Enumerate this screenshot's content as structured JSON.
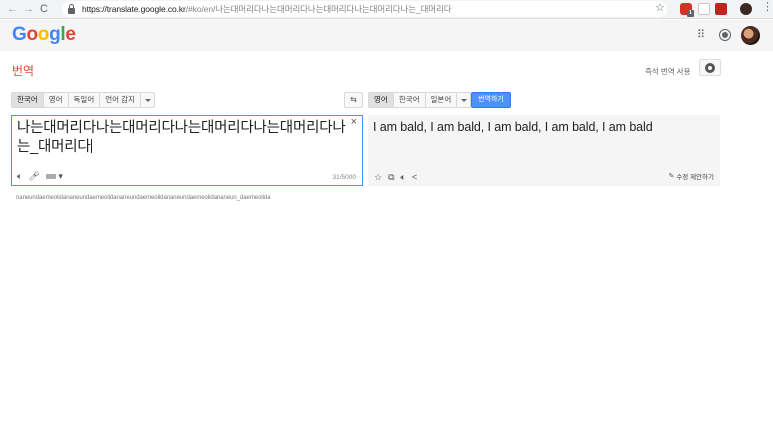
{
  "browser": {
    "url_host": "https://translate.google.co.kr",
    "url_path": "/#ko/en/나는대머리다나는대머리다나는대머리다나는대머리다나는_대머리다",
    "back": "←",
    "forward": "→",
    "reload": "C",
    "star": "☆",
    "menu": "⋮",
    "ext_badge": "1"
  },
  "header": {
    "logo": [
      "G",
      "o",
      "o",
      "g",
      "l",
      "e"
    ],
    "apps_icon": "⠿"
  },
  "page": {
    "title": "번역",
    "instant_label": "즉석 번역 사용"
  },
  "source_langs": {
    "options": [
      "한국어",
      "영어",
      "독일어",
      "언어 감지"
    ]
  },
  "swap_icon": "⇆",
  "target_langs": {
    "options": [
      "영어",
      "한국어",
      "일본어"
    ],
    "translate_button": "번역하기"
  },
  "source": {
    "text": "나는대머리다나는대머리다나는대머리다나는대머리다나는_대머리다",
    "clear": "×",
    "char_count": "31/5000",
    "icons": [
      "speaker-icon",
      "mic-icon",
      "keyboard-icon"
    ]
  },
  "result": {
    "text": "I am bald, I am bald, I am bald, I am bald, I am bald",
    "suggest_label": "수정 제안하기",
    "icons": [
      "star-icon",
      "copy-icon",
      "speaker-icon",
      "share-icon"
    ]
  },
  "transliteration": "naneundaemeolidananeundaemeolidananeundaemeolidananeundaemeolidananeun_daemeolida"
}
